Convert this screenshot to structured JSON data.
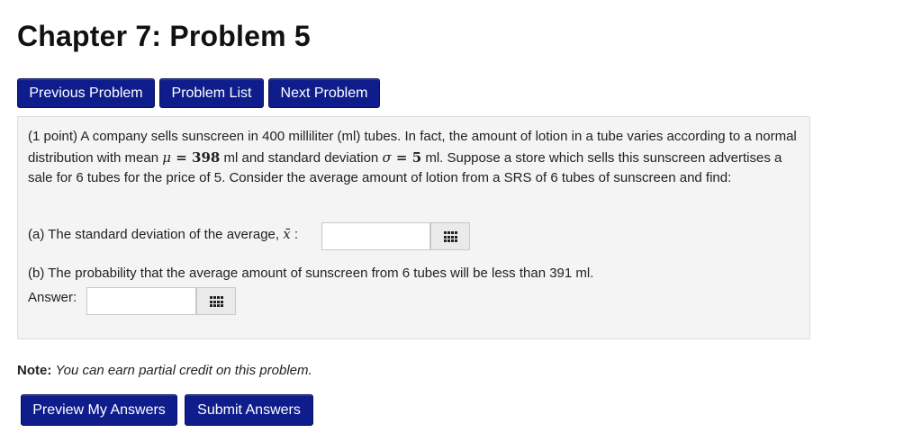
{
  "page": {
    "title": "Chapter 7: Problem 5"
  },
  "nav": {
    "previous": "Previous Problem",
    "list": "Problem List",
    "next": "Next Problem"
  },
  "problem": {
    "points": "(1 point)",
    "text_1": " A company sells sunscreen in 400 milliliter (ml) tubes. In fact, the amount of lotion in a tube varies according to a normal distribution with mean ",
    "mu_symbol": "μ",
    "eq": " = ",
    "mu_value": "398",
    "text_2": " ml and standard deviation ",
    "sigma_symbol": "σ",
    "sigma_value": "5",
    "text_3": " ml. Suppose a store which sells this sunscreen advertises a sale for 6 tubes for the price of 5. Consider the average amount of lotion from a SRS of 6 tubes of sunscreen and find:",
    "part_a": {
      "label": "(a) The standard deviation of the average, ",
      "symbol": "x̄",
      "colon": " :",
      "value": "",
      "grid_icon": "grid-icon"
    },
    "part_b": {
      "label": "(b) The probability that the average amount of sunscreen from 6 tubes will be less than 391 ml.",
      "answer_label": "Answer:",
      "value": "",
      "grid_icon": "grid-icon"
    }
  },
  "note": {
    "label": "Note:",
    "text": "You can earn partial credit on this problem."
  },
  "actions": {
    "preview": "Preview My Answers",
    "submit": "Submit Answers"
  },
  "colors": {
    "button_bg": "#0f1d8c",
    "panel_bg": "#f4f4f4"
  }
}
